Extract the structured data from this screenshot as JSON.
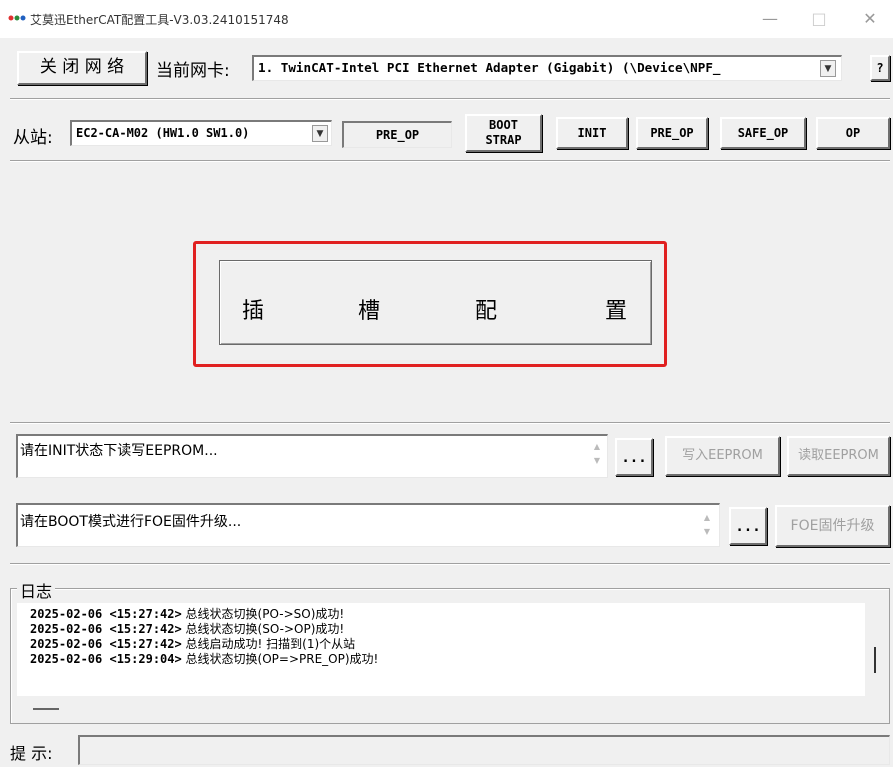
{
  "window": {
    "title": "艾莫迅EtherCAT配置工具-V3.03.2410151748",
    "minimize": "—",
    "maximize": "□",
    "close": "✕"
  },
  "toolbar": {
    "close_network": "关 闭 网 络",
    "adapter_label": "当前网卡:",
    "adapter_value": "1. TwinCAT-Intel PCI Ethernet Adapter (Gigabit) (\\Device\\NPF_",
    "help": "?"
  },
  "slave": {
    "label": "从站:",
    "selected": "EC2-CA-M02 (HW1.0 SW1.0)",
    "state": "PRE_OP",
    "buttons": {
      "boot_line1": "BOOT",
      "boot_line2": "STRAP",
      "init": "INIT",
      "pre_op": "PRE_OP",
      "safe_op": "SAFE_OP",
      "op": "OP"
    }
  },
  "slot_config": {
    "chars": [
      "插",
      "槽",
      "配",
      "置"
    ],
    "highlight_color": "#e02020"
  },
  "eeprom": {
    "text": "请在INIT状态下读写EEPROM...",
    "browse": "...",
    "write": "写入EEPROM",
    "read": "读取EEPROM"
  },
  "foe": {
    "text": "请在BOOT模式进行FOE固件升级...",
    "browse": "...",
    "upgrade": "FOE固件升级"
  },
  "log": {
    "title": "日志",
    "entries": [
      {
        "ts": "2025-02-06 <15:27:42>",
        "msg": "总线状态切换(PO->SO)成功!"
      },
      {
        "ts": "2025-02-06 <15:27:42>",
        "msg": "总线状态切换(SO->OP)成功!"
      },
      {
        "ts": "2025-02-06 <15:27:42>",
        "msg": "总线启动成功! 扫描到(1)个从站"
      },
      {
        "ts": "2025-02-06 <15:29:04>",
        "msg": "总线状态切换(OP=>PRE_OP)成功!"
      }
    ]
  },
  "status": {
    "label": "提 示:",
    "value": ""
  }
}
